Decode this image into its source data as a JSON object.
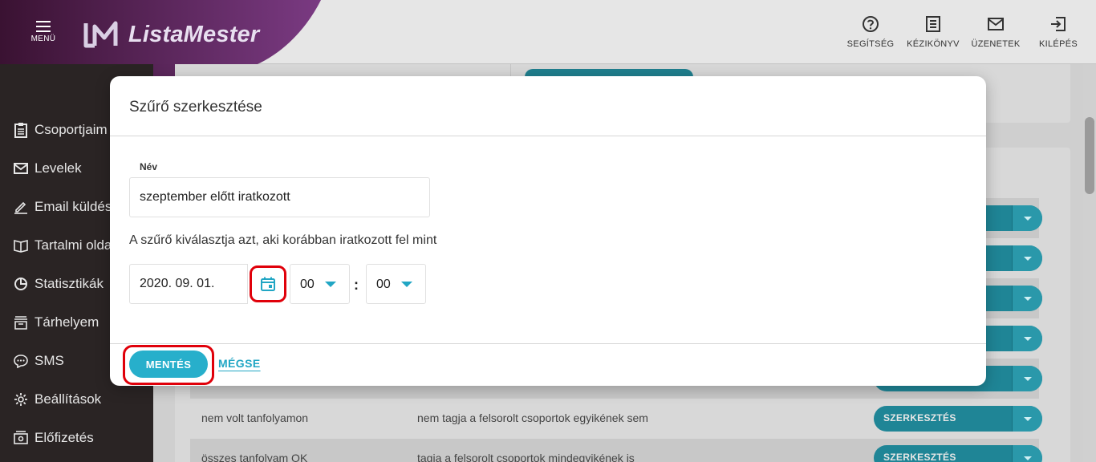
{
  "header": {
    "menu_label": "MENÜ",
    "logo_text": "ListaMester",
    "actions": [
      {
        "label": "SEGÍTSÉG",
        "icon": "help-icon"
      },
      {
        "label": "KÉZIKÖNYV",
        "icon": "manual-icon"
      },
      {
        "label": "ÜZENETEK",
        "icon": "mail-icon"
      },
      {
        "label": "KILÉPÉS",
        "icon": "logout-icon"
      }
    ]
  },
  "sidebar": {
    "items": [
      {
        "label": "Csoportjaim",
        "icon": "clipboard-icon"
      },
      {
        "label": "Levelek",
        "icon": "envelope-icon"
      },
      {
        "label": "Email küldés",
        "icon": "pencil-icon"
      },
      {
        "label": "Tartalmi oldalak",
        "icon": "book-icon"
      },
      {
        "label": "Statisztikák",
        "icon": "pie-chart-icon"
      },
      {
        "label": "Tárhelyem",
        "icon": "archive-icon"
      },
      {
        "label": "SMS",
        "icon": "chat-icon"
      },
      {
        "label": "Beállítások",
        "icon": "gear-icon"
      },
      {
        "label": "Előfizetés",
        "icon": "billing-icon"
      }
    ]
  },
  "background_table": {
    "edit_label": "SZERKESZTÉS",
    "rows": [
      {
        "name": "nem volt tanfolyamon",
        "condition": "nem tagja a felsorolt csoportok egyikének sem"
      },
      {
        "name": "összes tanfolyam OK",
        "condition": "tagja a felsorolt csoportok mindegyikének is"
      }
    ]
  },
  "modal": {
    "title": "Szűrő szerkesztése",
    "name_label": "Név",
    "name_value": "szeptember előtt iratkozott",
    "description": "A szűrő kiválasztja azt, aki korábban iratkozott fel mint",
    "date_value": "2020. 09. 01.",
    "hour_value": "00",
    "minute_value": "00",
    "time_separator": ":",
    "save_label": "MENTÉS",
    "cancel_label": "MÉGSE"
  },
  "colors": {
    "accent": "#27afcb",
    "sidebar_bg": "#2a2424",
    "brand_purple": "#5a1f5c",
    "highlight_red": "#e0000a"
  }
}
